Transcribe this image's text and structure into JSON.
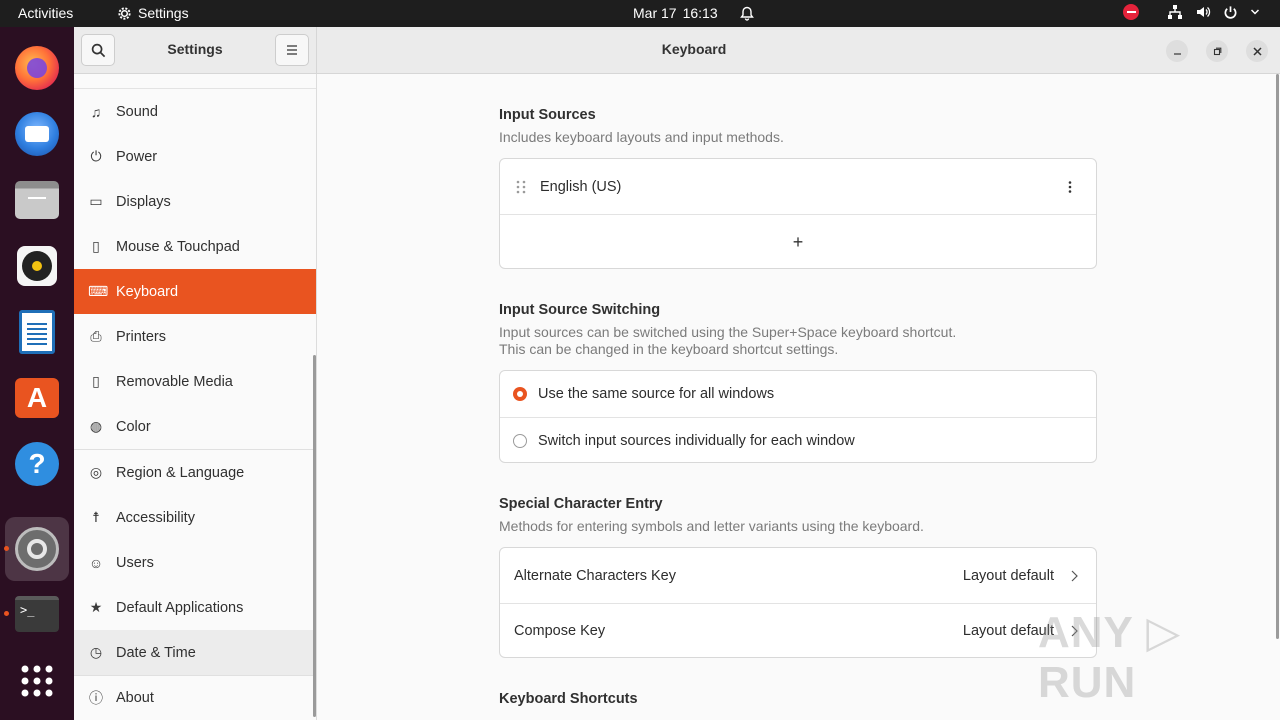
{
  "topbar": {
    "activities": "Activities",
    "app_name": "Settings",
    "date": "Mar 17",
    "time": "16:13"
  },
  "dock": {
    "apps": [
      "firefox",
      "thunderbird",
      "files",
      "rhythmbox",
      "libreoffice-writer",
      "app-center",
      "help",
      "settings",
      "terminal",
      "show-apps"
    ]
  },
  "header": {
    "sidebar_title": "Settings",
    "page_title": "Keyboard"
  },
  "sidebar": {
    "items": [
      {
        "label": "Sound",
        "icon": "music-note-icon"
      },
      {
        "label": "Power",
        "icon": "power-icon"
      },
      {
        "label": "Displays",
        "icon": "display-icon"
      },
      {
        "label": "Mouse & Touchpad",
        "icon": "mouse-icon"
      },
      {
        "label": "Keyboard",
        "icon": "keyboard-icon",
        "selected": true
      },
      {
        "label": "Printers",
        "icon": "printer-icon"
      },
      {
        "label": "Removable Media",
        "icon": "usb-icon"
      },
      {
        "label": "Color",
        "icon": "color-icon"
      },
      {
        "label": "Region & Language",
        "icon": "globe-icon"
      },
      {
        "label": "Accessibility",
        "icon": "accessibility-icon"
      },
      {
        "label": "Users",
        "icon": "users-icon"
      },
      {
        "label": "Default Applications",
        "icon": "star-icon"
      },
      {
        "label": "Date & Time",
        "icon": "clock-icon"
      },
      {
        "label": "About",
        "icon": "info-icon"
      }
    ]
  },
  "input_sources": {
    "title": "Input Sources",
    "subtitle": "Includes keyboard layouts and input methods.",
    "sources": [
      "English (US)"
    ],
    "add_label": "+"
  },
  "switching": {
    "title": "Input Source Switching",
    "subtitle_line1": "Input sources can be switched using the Super+Space keyboard shortcut.",
    "subtitle_line2": "This can be changed in the keyboard shortcut settings.",
    "option_same": "Use the same source for all windows",
    "option_individual": "Switch input sources individually for each window",
    "selected": "same"
  },
  "special_chars": {
    "title": "Special Character Entry",
    "subtitle": "Methods for entering symbols and letter variants using the keyboard.",
    "alt_key_label": "Alternate Characters Key",
    "alt_key_value": "Layout default",
    "compose_label": "Compose Key",
    "compose_value": "Layout default"
  },
  "shortcuts": {
    "title": "Keyboard Shortcuts"
  },
  "colors": {
    "accent": "#e95420",
    "topbar": "#1e1e1e",
    "dock": "#2b0f22"
  }
}
